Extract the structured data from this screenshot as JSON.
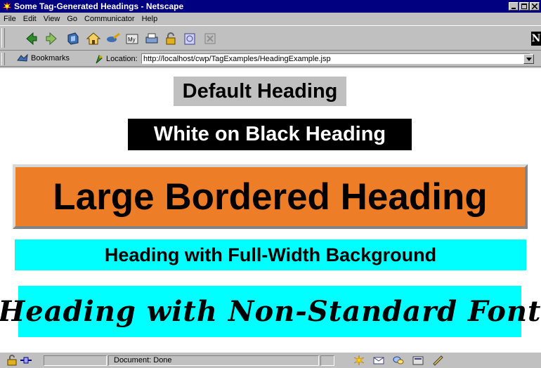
{
  "window": {
    "title": "Some Tag-Generated Headings - Netscape"
  },
  "menu": {
    "items": [
      {
        "label": "File"
      },
      {
        "label": "Edit"
      },
      {
        "label": "View"
      },
      {
        "label": "Go"
      },
      {
        "label": "Communicator"
      },
      {
        "label": "Help"
      }
    ]
  },
  "toolbar": {
    "icons": [
      "back-icon",
      "forward-icon",
      "reload-icon",
      "home-icon",
      "search-icon",
      "my-netscape-icon",
      "print-icon",
      "security-icon",
      "shop-icon",
      "stop-icon"
    ]
  },
  "location_bar": {
    "bookmarks_label": "Bookmarks",
    "location_label": "Location:",
    "url": "http://localhost/cwp/TagExamples/HeadingExample.jsp"
  },
  "content": {
    "default_heading": "Default Heading",
    "white_on_black_heading": "White on Black Heading",
    "large_bordered_heading": "Large Bordered Heading",
    "full_width_heading": "Heading with Full-Width Background",
    "non_standard_font_heading": "Heading with Non-Standard Font"
  },
  "status": {
    "text": "Document: Done"
  },
  "colors": {
    "gray_bg": "#c0c0c0",
    "black_bg": "#000000",
    "orange_bg": "#ee7d28",
    "cyan_bg": "#00ffff"
  }
}
